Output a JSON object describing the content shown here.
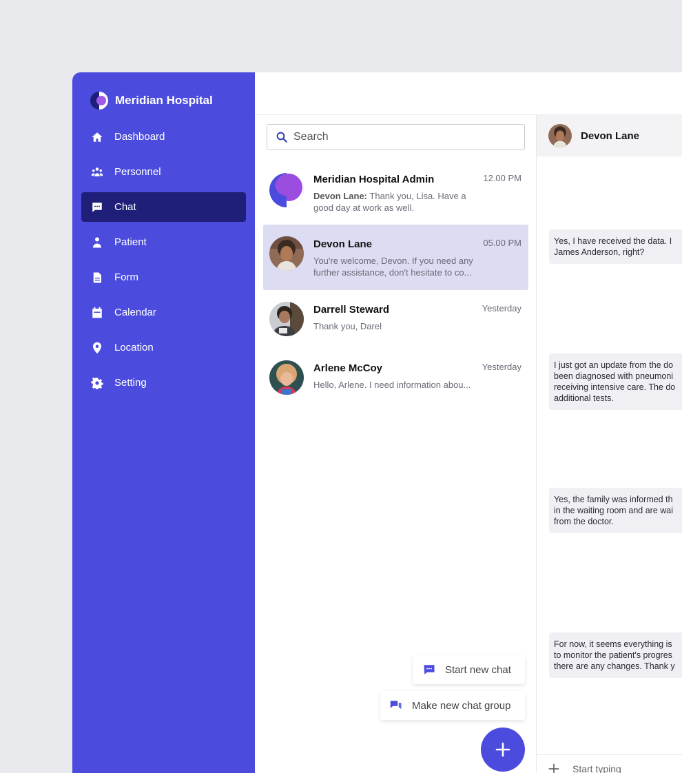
{
  "brand": {
    "name": "Meridian Hospital"
  },
  "nav": [
    {
      "label": "Dashboard",
      "icon": "home-icon"
    },
    {
      "label": "Personnel",
      "icon": "people-icon"
    },
    {
      "label": "Chat",
      "icon": "chat-icon",
      "active": true
    },
    {
      "label": "Patient",
      "icon": "person-icon"
    },
    {
      "label": "Form",
      "icon": "document-icon"
    },
    {
      "label": "Calendar",
      "icon": "calendar-icon"
    },
    {
      "label": "Location",
      "icon": "location-pin-icon"
    },
    {
      "label": "Setting",
      "icon": "gear-icon"
    }
  ],
  "search": {
    "placeholder": "Search"
  },
  "chats": [
    {
      "name": "Meridian Hospital Admin",
      "time": "12.00 PM",
      "sender": "Devon Lane:",
      "preview": "Thank you, Lisa. Have a good day at work as well."
    },
    {
      "name": "Devon Lane",
      "time": "05.00 PM",
      "preview": "You're welcome, Devon. If you need any further assistance, don't hesitate to co..."
    },
    {
      "name": "Darrell Steward",
      "time": "Yesterday",
      "preview": "Thank you, Darel"
    },
    {
      "name": "Arlene McCoy",
      "time": "Yesterday",
      "preview": "Hello, Arlene. I need information abou..."
    }
  ],
  "actions": {
    "start_chat": "Start new chat",
    "new_group": "Make new chat group"
  },
  "conversation": {
    "contact": "Devon Lane",
    "messages": [
      [
        "Yes, I have received the data. I",
        "James Anderson, right?"
      ],
      [
        "I just got an update from the do",
        "been diagnosed with pneumoni",
        "receiving intensive care. The do",
        "additional tests."
      ],
      [
        "Yes, the family was informed th",
        "in the waiting room and are wai",
        "from the doctor."
      ],
      [
        "For now, it seems everything is",
        "to monitor the patient's progres",
        "there are any changes. Thank y"
      ]
    ],
    "compose_placeholder": "Start typing"
  },
  "colors": {
    "primary": "#4b4cdd",
    "active_nav": "#1f1f7a",
    "active_chat": "#dcdcf2"
  }
}
